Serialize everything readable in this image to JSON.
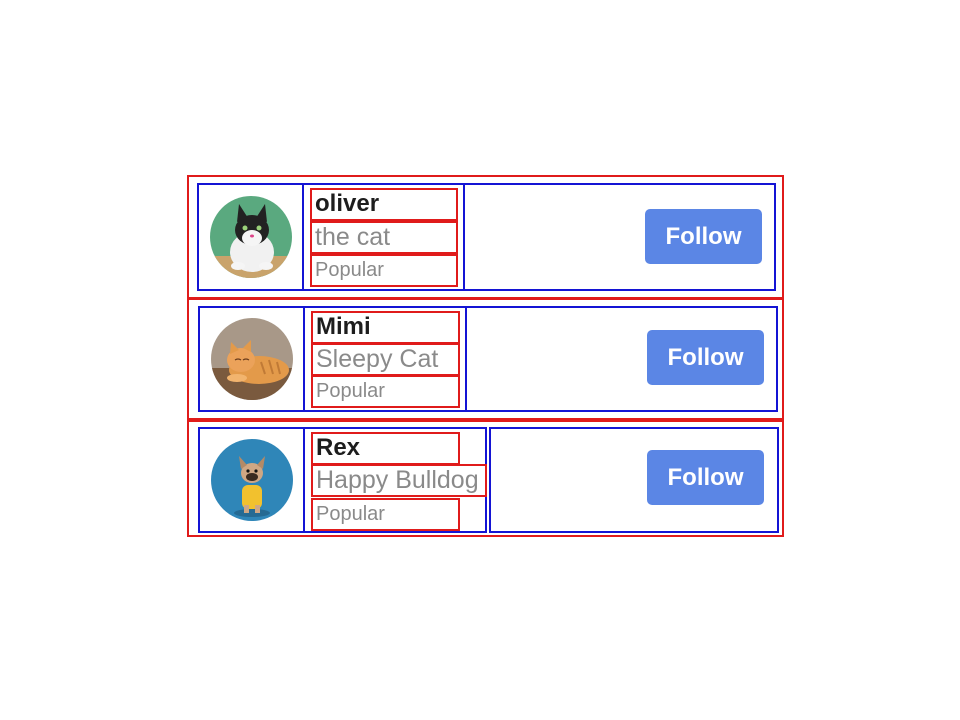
{
  "profiles": [
    {
      "name": "oliver",
      "description": "the cat",
      "tag": "Popular",
      "follow_label": "Follow",
      "avatar": "tuxedo-cat-photo",
      "avatar_bg": "#5aa97f"
    },
    {
      "name": "Mimi",
      "description": "Sleepy Cat",
      "tag": "Popular",
      "follow_label": "Follow",
      "avatar": "orange-tabby-cat-photo",
      "avatar_bg": "#8b7a6a"
    },
    {
      "name": "Rex",
      "description": "Happy Bulldog",
      "tag": "Popular",
      "follow_label": "Follow",
      "avatar": "french-bulldog-photo",
      "avatar_bg": "#2f86b8"
    }
  ],
  "colors": {
    "button": "#5b86e5",
    "outline_outer": "#e01b1b",
    "outline_inner": "#1414d4",
    "name_text": "#1d1d1d",
    "secondary_text": "#8a8a8a"
  }
}
